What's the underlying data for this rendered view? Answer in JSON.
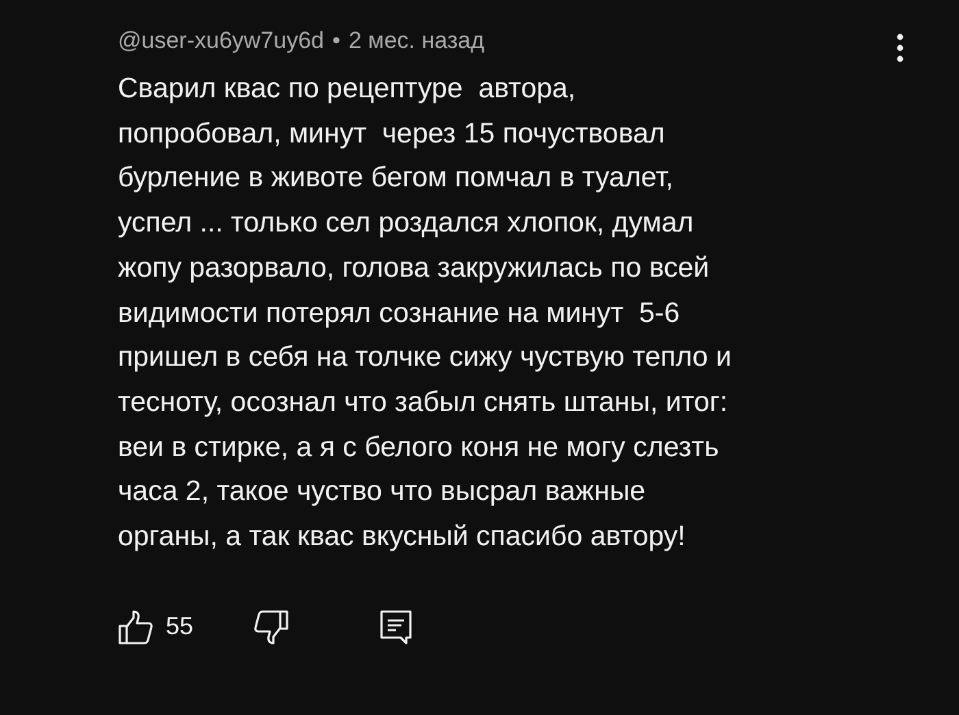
{
  "comment": {
    "author": "@user-xu6yw7uy6d",
    "separator": "•",
    "time": "2 мес. назад",
    "text": "Сварил квас по рецептуре  автора,\nпопробовал, минут  через 15 почуствовал\nбурление в животе бегом помчал в туалет,\nуспел ... только сел роздался хлопок, думал\nжопу разорвало, голова закружилась по всей\nвидимости потерял сознание на минут  5-6\nпришел в себя на толчке сижу чуствую тепло и\nтесноту, осознал что забыл снять штаны, итог:\nвеи в стирке, а я с белого коня не могу слезть\nчаса 2, такое чуство что высрал важные\nорганы, а так квас вкусный спасибо автору!",
    "likes": "55"
  }
}
